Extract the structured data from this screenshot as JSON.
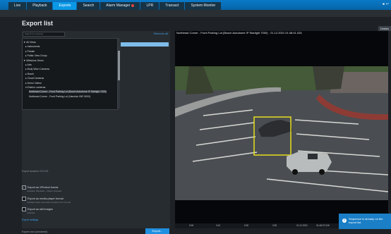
{
  "topbar": {
    "tabs": [
      {
        "label": "Live"
      },
      {
        "label": "Playback"
      },
      {
        "label": "Exports",
        "active": true
      },
      {
        "label": "Search"
      },
      {
        "label": "Alarm Manager"
      },
      {
        "label": "LPR"
      },
      {
        "label": "Transact"
      },
      {
        "label": "System Monitor"
      }
    ],
    "right_label": "◄ ↩"
  },
  "page": {
    "title": "Export list",
    "top_right_button": "Details"
  },
  "left": {
    "search_placeholder": "Search for cameras",
    "remove_all": "Remove all",
    "tree": [
      "▼ All Views",
      "▸ Instruments",
      "▸ Private",
      "▸ Public View Group",
      "▼ Milestone Demo",
      "▸ Axis",
      "▸ Body Worn Cameras",
      "▸ Bosch",
      "▸ Cloud Cameras",
      "▸ Demo Videos",
      "▾ Exterior cameras",
      "Northeast Corner - Front Parking Lot (Bosch Autodome IP Starlight 7000)",
      "Northeast Corner - Front Parking Lot (Hanwha XNF-9000)"
    ],
    "duration": "Export duration: 00:1:00",
    "options": [
      {
        "label": "Export as XProtect format",
        "detail": "Included: Windows – Player included",
        "checked": "✓"
      },
      {
        "label": "Export as media player format",
        "detail": "Included video and audio included: FS: Format",
        "checked": ""
      },
      {
        "label": "Export as still images",
        "detail": "Included",
        "checked": ""
      }
    ],
    "export_settings": "Export settings",
    "export_name": "Export xxxx (unnamed)",
    "export_button": "Export..."
  },
  "video": {
    "title": "Northeast Corner - Front Parking Lot (Bosch Autodome IP Starlight 7000) · 21.12.2021 01:48:41.026",
    "ticks": [
      "0:00",
      "0:10",
      "0:20",
      "0:30",
      "21.12.2021",
      "01:48:07.026",
      "0:50",
      "1:00"
    ]
  },
  "toast": {
    "icon": "i",
    "text": "Sequence is already on the export list."
  }
}
